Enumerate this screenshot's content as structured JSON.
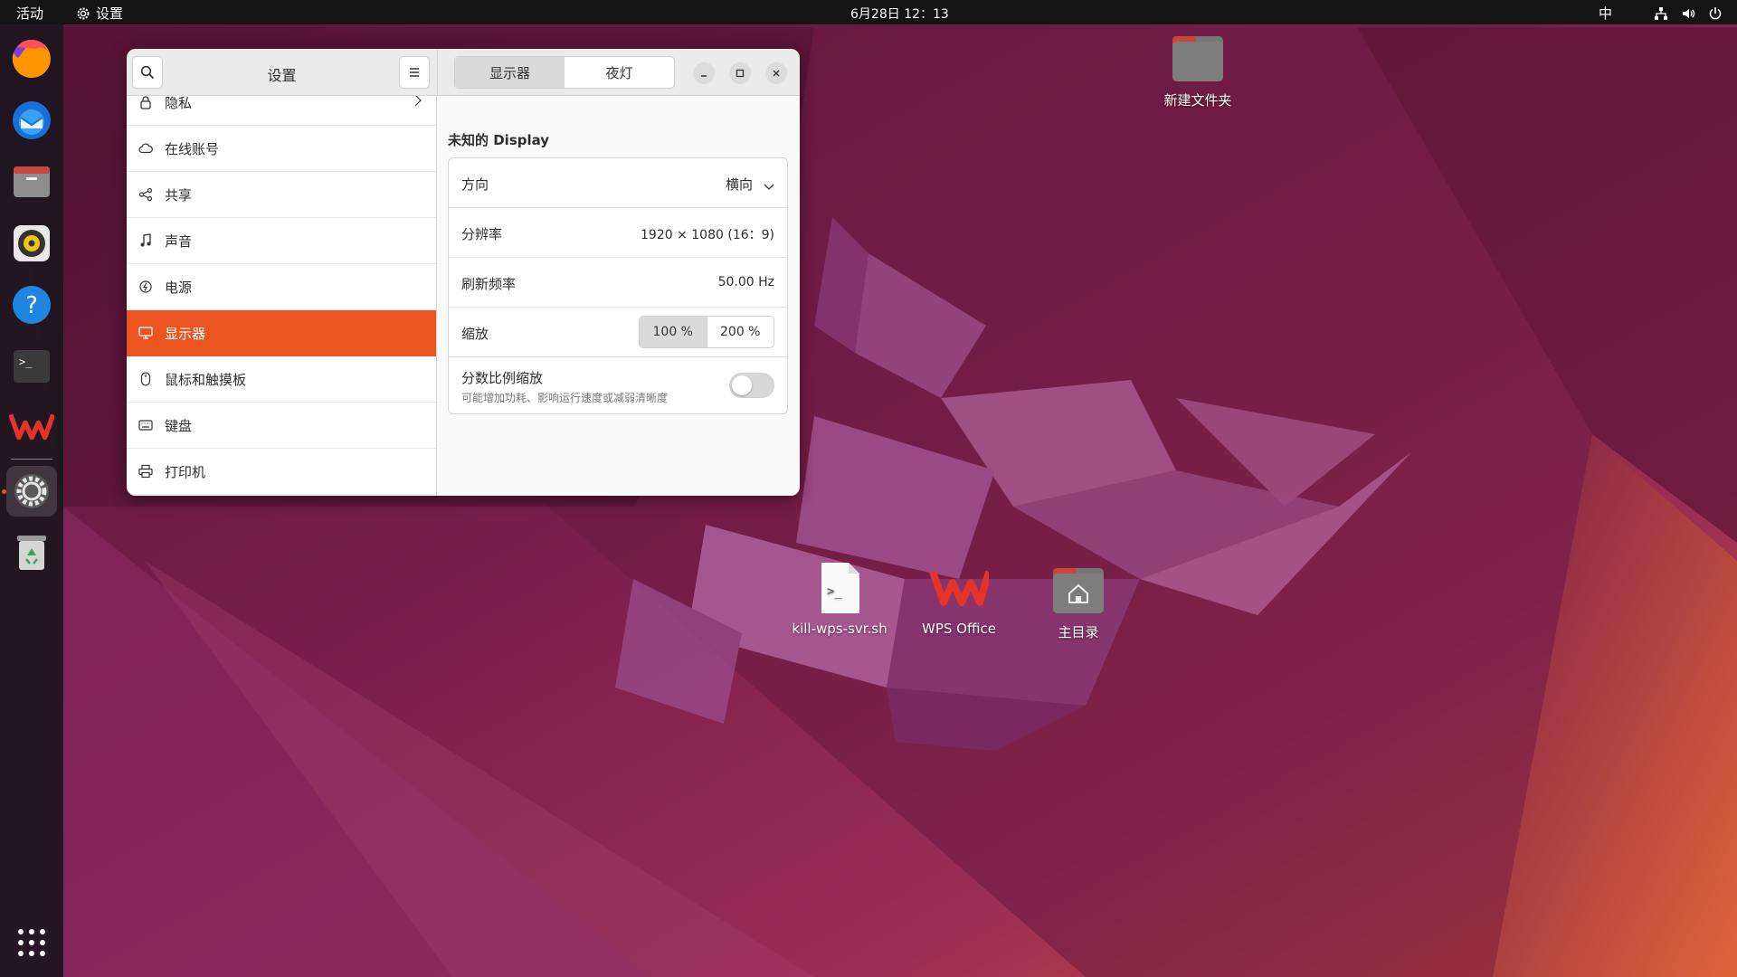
{
  "topbar": {
    "activities": "活动",
    "app_name": "设置",
    "clock": "6月28日  12：13",
    "ime": "中"
  },
  "dock": {
    "items": [
      {
        "name": "firefox-icon"
      },
      {
        "name": "thunderbird-icon"
      },
      {
        "name": "files-icon"
      },
      {
        "name": "rhythmbox-icon"
      },
      {
        "name": "help-icon"
      },
      {
        "name": "terminal-icon"
      },
      {
        "name": "wps-icon"
      },
      {
        "name": "settings-icon",
        "active": true
      },
      {
        "name": "trash-icon"
      }
    ]
  },
  "settings": {
    "title": "设置",
    "tabs": [
      "显示器",
      "夜灯"
    ],
    "active_tab": "显示器",
    "sidebar": [
      {
        "label": "隐私",
        "icon": "lock-icon",
        "has_chevron": true
      },
      {
        "label": "在线账号",
        "icon": "cloud-icon"
      },
      {
        "label": "共享",
        "icon": "share-icon"
      },
      {
        "label": "声音",
        "icon": "music-note-icon"
      },
      {
        "label": "电源",
        "icon": "power-icon"
      },
      {
        "label": "显示器",
        "icon": "display-icon",
        "selected": true
      },
      {
        "label": "鼠标和触摸板",
        "icon": "mouse-icon"
      },
      {
        "label": "键盘",
        "icon": "keyboard-icon"
      },
      {
        "label": "打印机",
        "icon": "printer-icon"
      }
    ],
    "display": {
      "name": "未知的 Display",
      "orientation_label": "方向",
      "orientation_value": "横向",
      "resolution_label": "分辨率",
      "resolution_value": "1920 × 1080 (16：9)",
      "refresh_label": "刷新频率",
      "refresh_value": "50.00 Hz",
      "scale_label": "缩放",
      "scale_options": [
        "100 %",
        "200 %"
      ],
      "scale_selected": "100 %",
      "fractional_label": "分数比例缩放",
      "fractional_sub": "可能增加功耗、影响运行速度或减弱清晰度",
      "fractional_enabled": false
    }
  },
  "desktop": {
    "icons": [
      {
        "label": "新建文件夹",
        "icon": "folder-icon"
      },
      {
        "label": "kill-wps-svr.sh",
        "icon": "script-file-icon"
      },
      {
        "label": "WPS Office",
        "icon": "wps-office-icon"
      },
      {
        "label": "主目录",
        "icon": "home-folder-icon"
      }
    ]
  },
  "colors": {
    "accent": "#e95420",
    "topbar": "#141414",
    "dock": "#1c161e"
  }
}
